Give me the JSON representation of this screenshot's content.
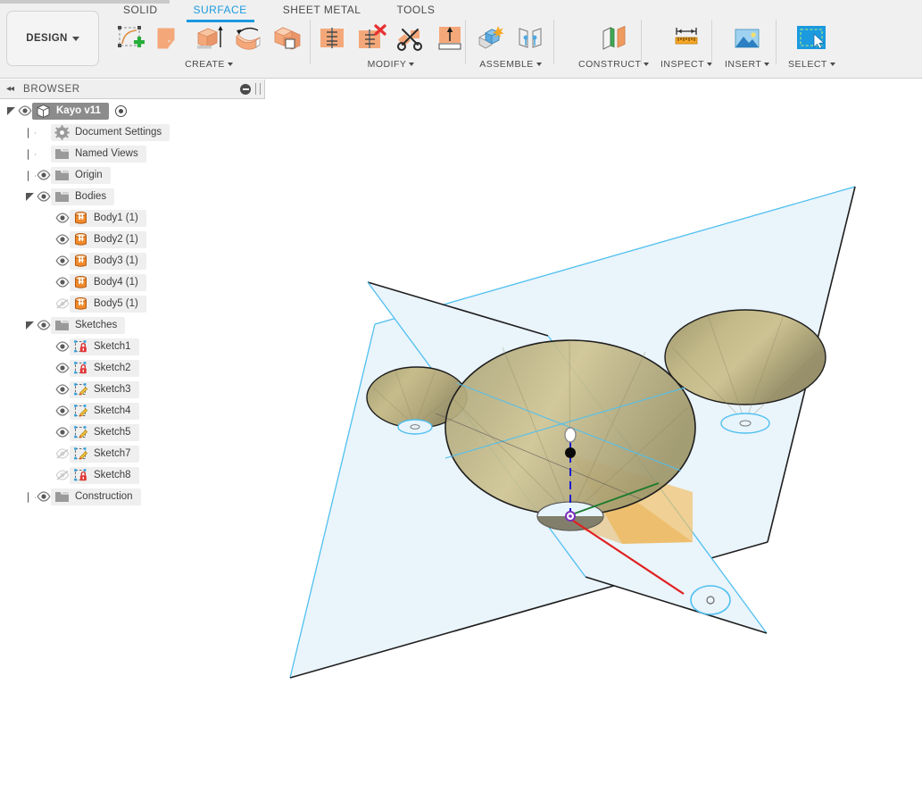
{
  "app": {
    "workspace_button": "DESIGN",
    "tabs": [
      {
        "label": "SOLID",
        "active": false
      },
      {
        "label": "SURFACE",
        "active": true
      },
      {
        "label": "SHEET METAL",
        "active": false
      },
      {
        "label": "TOOLS",
        "active": false
      }
    ],
    "accent_color": "#1b9ae0"
  },
  "ribbon": {
    "groups": [
      {
        "name": "CREATE",
        "label": "CREATE",
        "has_dropdown": true,
        "tools": [
          {
            "icon": "create-sketch-icon",
            "title": "Create Sketch"
          },
          {
            "icon": "patch-surface-icon",
            "title": "Patch"
          },
          {
            "icon": "extrude-surface-icon",
            "title": "Extrude"
          },
          {
            "icon": "revolve-surface-icon",
            "title": "Revolve"
          },
          {
            "icon": "offset-surface-icon",
            "title": "Offset"
          }
        ]
      },
      {
        "name": "MODIFY",
        "label": "MODIFY",
        "has_dropdown": true,
        "tools": [
          {
            "icon": "stitch-icon",
            "title": "Stitch"
          },
          {
            "icon": "unstitch-icon",
            "title": "Unstitch"
          },
          {
            "icon": "trim-icon",
            "title": "Trim"
          },
          {
            "icon": "extend-icon",
            "title": "Extend"
          }
        ]
      },
      {
        "name": "ASSEMBLE",
        "label": "ASSEMBLE",
        "has_dropdown": true,
        "tools": [
          {
            "icon": "new-component-icon",
            "title": "New Component"
          },
          {
            "icon": "joint-icon",
            "title": "Joint"
          }
        ]
      },
      {
        "name": "CONSTRUCT",
        "label": "CONSTRUCT",
        "has_dropdown": true,
        "tools": [
          {
            "icon": "offset-plane-icon",
            "title": "Offset Plane"
          }
        ]
      },
      {
        "name": "INSPECT",
        "label": "INSPECT",
        "has_dropdown": true,
        "tools": [
          {
            "icon": "measure-ruler-icon",
            "title": "Measure"
          }
        ]
      },
      {
        "name": "INSERT",
        "label": "INSERT",
        "has_dropdown": true,
        "tools": [
          {
            "icon": "insert-image-icon",
            "title": "Insert Image"
          }
        ]
      },
      {
        "name": "SELECT",
        "label": "SELECT",
        "has_dropdown": true,
        "tools": [
          {
            "icon": "select-window-icon",
            "title": "Select"
          }
        ]
      }
    ]
  },
  "browser": {
    "title": "BROWSER",
    "collapse_icon": "collapse-left-icon",
    "minimize_icon": "minimize-icon",
    "resize_icon": "panel-resize-grip",
    "root": {
      "label": "Kayo v11",
      "icon": "component-cube-icon",
      "selected": true,
      "expanded": true,
      "visible": true,
      "has_radio": true
    },
    "nodes": [
      {
        "label": "Document Settings",
        "icon": "gear-icon",
        "indent": 1,
        "expand": "closed",
        "eye": "none"
      },
      {
        "label": "Named Views",
        "icon": "folder-icon",
        "indent": 1,
        "expand": "closed",
        "eye": "none"
      },
      {
        "label": "Origin",
        "icon": "folder-icon",
        "indent": 1,
        "expand": "closed",
        "eye": "visible"
      },
      {
        "label": "Bodies",
        "icon": "folder-icon",
        "indent": 1,
        "expand": "open",
        "eye": "visible"
      },
      {
        "label": "Body1 (1)",
        "icon": "body-icon",
        "indent": 2,
        "expand": "none",
        "eye": "visible"
      },
      {
        "label": "Body2 (1)",
        "icon": "body-icon",
        "indent": 2,
        "expand": "none",
        "eye": "visible"
      },
      {
        "label": "Body3 (1)",
        "icon": "body-icon",
        "indent": 2,
        "expand": "none",
        "eye": "visible"
      },
      {
        "label": "Body4 (1)",
        "icon": "body-icon",
        "indent": 2,
        "expand": "none",
        "eye": "visible"
      },
      {
        "label": "Body5 (1)",
        "icon": "body-icon",
        "indent": 2,
        "expand": "none",
        "eye": "hidden"
      },
      {
        "label": "Sketches",
        "icon": "folder-icon",
        "indent": 1,
        "expand": "open",
        "eye": "visible"
      },
      {
        "label": "Sketch1",
        "icon": "sketch-locked-icon",
        "indent": 2,
        "expand": "none",
        "eye": "visible"
      },
      {
        "label": "Sketch2",
        "icon": "sketch-locked-icon",
        "indent": 2,
        "expand": "none",
        "eye": "visible"
      },
      {
        "label": "Sketch3",
        "icon": "sketch-editable-icon",
        "indent": 2,
        "expand": "none",
        "eye": "visible"
      },
      {
        "label": "Sketch4",
        "icon": "sketch-editable-icon",
        "indent": 2,
        "expand": "none",
        "eye": "visible"
      },
      {
        "label": "Sketch5",
        "icon": "sketch-editable-icon",
        "indent": 2,
        "expand": "none",
        "eye": "visible"
      },
      {
        "label": "Sketch7",
        "icon": "sketch-editable-icon",
        "indent": 2,
        "expand": "none",
        "eye": "hidden"
      },
      {
        "label": "Sketch8",
        "icon": "sketch-locked-icon",
        "indent": 2,
        "expand": "none",
        "eye": "hidden"
      },
      {
        "label": "Construction",
        "icon": "folder-icon",
        "indent": 1,
        "expand": "closed",
        "eye": "visible"
      }
    ]
  },
  "viewport": {
    "name": "3d-canvas",
    "background_color": "#ffffff",
    "plane_fill": "#eaf4fb",
    "plane_edge_highlight": "#4fc0f0",
    "plane_edge_dark": "#1a1a1a",
    "body_fill_light": "#c8bd88",
    "body_fill_dark": "#9a9468",
    "body_edge": "#2a2a2a",
    "sketch_region_fill": "#f2c168",
    "axis_x_color": "#e02020",
    "axis_y_color": "#1a7a2e",
    "axis_z_color": "#1a1ad0",
    "origin_marker_color": "#7b2fbe",
    "elements": [
      {
        "name": "cone-body-center",
        "kind": "revolved-cone",
        "size": "large"
      },
      {
        "name": "cone-body-left",
        "kind": "revolved-cone",
        "size": "small"
      },
      {
        "name": "cone-body-right",
        "kind": "revolved-cone",
        "size": "medium"
      },
      {
        "name": "construction-plane-front",
        "kind": "plane"
      },
      {
        "name": "construction-plane-side",
        "kind": "plane"
      },
      {
        "name": "origin-point",
        "kind": "point"
      },
      {
        "name": "axis-z-line",
        "kind": "axis"
      },
      {
        "name": "profile-sketch-region",
        "kind": "sketch-face"
      }
    ]
  }
}
